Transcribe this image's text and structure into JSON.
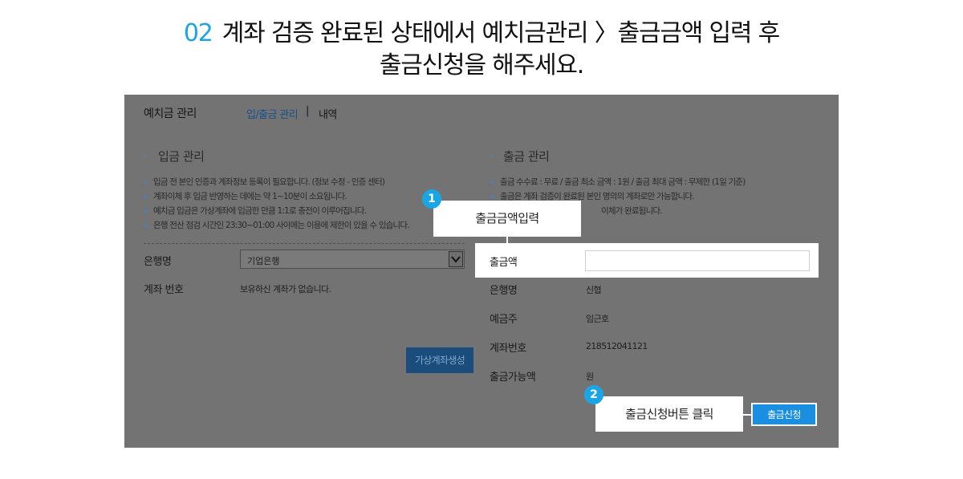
{
  "instruction": {
    "step_number": "02",
    "line1": "계좌 검증 완료된 상태에서 예치금관리 〉출금금액 입력 후",
    "line2": "출금신청을 해주세요."
  },
  "header": {
    "title": "예치금 관리",
    "tabs": [
      {
        "label": "입/출금 관리",
        "active": true
      },
      {
        "label": "내역",
        "active": false
      }
    ],
    "tab_separator": "|"
  },
  "deposit": {
    "section_title": "입금 관리",
    "notes": [
      "입금 전 본인 인증과 계좌정보 등록이 필요합니다. (정보 수정 - 인증 센터)",
      "계좌이체 후 입금 반영하는 데에는 약 1~10분이 소요됩니다.",
      "예치금 입금은 가상계좌에 입금한 만큼 1:1로 충전이 이루어집니다.",
      "은행 전산 점검 시간인 23:30~01:00 사이에는 이용에 제한이 있을 수 있습니다."
    ],
    "bank_label": "은행명",
    "bank_selected": "기업은행",
    "account_label": "계좌 번호",
    "account_value": "보유하신 계좌가 없습니다.",
    "create_button": "가상계좌생성"
  },
  "withdraw": {
    "section_title": "출금 관리",
    "notes": [
      "출금 수수료 : 무료 / 출금 최소 금액 : 1원 / 출금 최대 금액 : 무제한 (1일 기준)",
      "출금은 계좌 검증이 완료된 본인 명의의 계좌로만 가능합니다.",
      "이체가 완료됩니다."
    ],
    "amount_label": "출금액",
    "amount_value": "",
    "bank_label": "은행명",
    "bank_value": "신협",
    "holder_label": "예금주",
    "holder_value": "임근호",
    "account_label": "계좌번호",
    "account_value": "218512041121",
    "available_label": "출금가능액",
    "available_value": "원",
    "submit_button": "출금신청"
  },
  "callouts": [
    {
      "badge": "1",
      "text": "출금금액입력"
    },
    {
      "badge": "2",
      "text": "출금신청버튼 클릭"
    }
  ],
  "colors": {
    "accent": "#1aa6e6",
    "overlay": "#737373",
    "button_blue": "#1a8ee0"
  },
  "icons": {
    "section_marker": "chevron-right-icon",
    "select_arrow": "chevron-down-icon"
  }
}
